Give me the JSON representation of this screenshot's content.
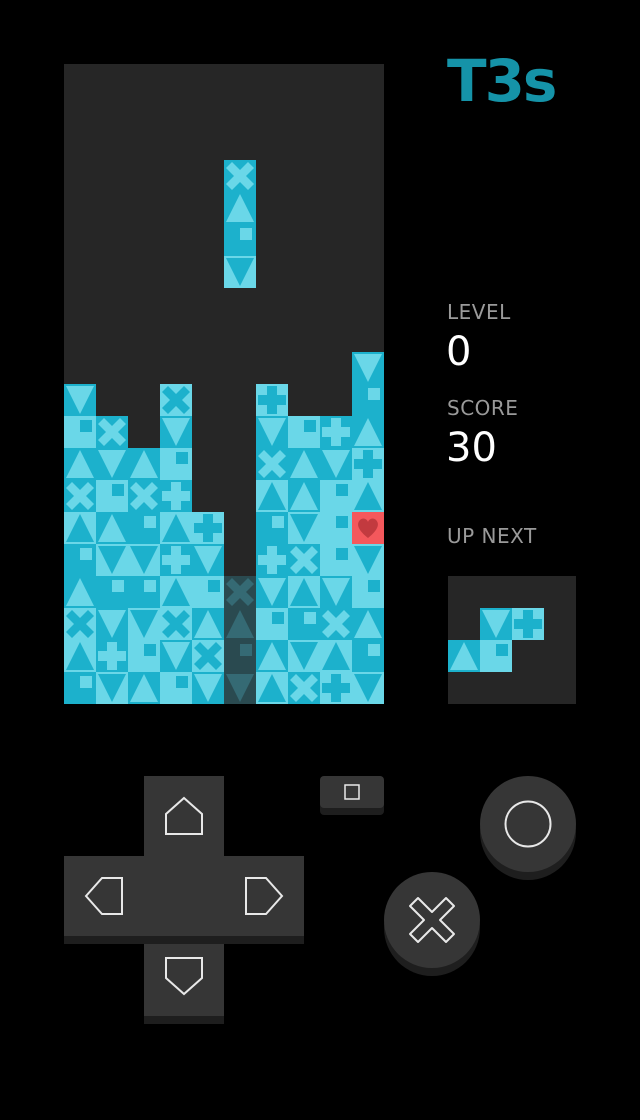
{
  "app_title": "T3s",
  "colors": {
    "board_bg": "#262626",
    "light": "#6ad7e8",
    "medium": "#1cb1cc",
    "ghost": "#2e6068",
    "red": "#f4585c",
    "title": "#1593a8",
    "label": "#9a9a9a"
  },
  "stats": {
    "level_label": "LEVEL",
    "level_value": "0",
    "score_label": "SCORE",
    "score_value": "30",
    "next_label": "UP NEXT"
  },
  "board": {
    "cols": 10,
    "rows": 20,
    "active_piece": [
      {
        "col": 5,
        "row": 3,
        "shape": "x",
        "tone": "m"
      },
      {
        "col": 5,
        "row": 4,
        "shape": "up",
        "tone": "m"
      },
      {
        "col": 5,
        "row": 5,
        "shape": "sq",
        "tone": "m"
      },
      {
        "col": 5,
        "row": 6,
        "shape": "down",
        "tone": "l"
      }
    ],
    "ghost_piece": [
      {
        "col": 5,
        "row": 16,
        "shape": "x"
      },
      {
        "col": 5,
        "row": 17,
        "shape": "up"
      },
      {
        "col": 5,
        "row": 18,
        "shape": "sq"
      },
      {
        "col": 5,
        "row": 19,
        "shape": "down"
      }
    ],
    "stack": [
      [
        "",
        "",
        "",
        "",
        "",
        "",
        "",
        "",
        "",
        "m:down"
      ],
      [
        "m:down",
        "",
        "",
        "l:x",
        "",
        "",
        "l:plus",
        "",
        "",
        "m:sq"
      ],
      [
        "l:sq",
        "m:x",
        "",
        "m:down",
        "",
        "",
        "m:down",
        "l:sq",
        "m:plus",
        "m:up"
      ],
      [
        "m:up",
        "m:down",
        "m:up",
        "l:sq",
        "",
        "",
        "m:x",
        "m:up",
        "m:down",
        "l:plus"
      ],
      [
        "m:x",
        "l:sq",
        "m:x",
        "m:plus",
        "",
        "",
        "l:up",
        "m:up",
        "l:sq",
        "l:up"
      ],
      [
        "l:up",
        "m:up",
        "m:sq",
        "l:up",
        "l:plus",
        "",
        "m:sq",
        "l:down",
        "l:sq",
        "r:heart"
      ],
      [
        "m:sq",
        "l:down",
        "l:down",
        "m:plus",
        "m:down",
        "",
        "m:plus",
        "m:x",
        "l:sq",
        "l:down"
      ],
      [
        "m:up",
        "m:sq",
        "m:sq",
        "l:up",
        "l:sq",
        "",
        "m:down",
        "l:up",
        "m:down",
        "l:sq"
      ],
      [
        "l:x",
        "m:down",
        "l:down",
        "l:x",
        "m:up",
        "",
        "l:sq",
        "m:sq",
        "m:x",
        "m:up"
      ],
      [
        "l:up",
        "m:plus",
        "l:sq",
        "m:down",
        "l:x",
        "",
        "m:up",
        "l:down",
        "l:up",
        "m:sq"
      ],
      [
        "m:sq",
        "l:down",
        "m:up",
        "l:sq",
        "m:down",
        "",
        "l:up",
        "m:x",
        "l:plus",
        "l:down"
      ]
    ]
  },
  "next_piece": [
    {
      "col": 1,
      "row": 1,
      "shape": "down",
      "tone": "m"
    },
    {
      "col": 2,
      "row": 1,
      "shape": "plus",
      "tone": "l"
    },
    {
      "col": 0,
      "row": 2,
      "shape": "up",
      "tone": "m"
    },
    {
      "col": 1,
      "row": 2,
      "shape": "sq",
      "tone": "l"
    }
  ],
  "controls": {
    "dpad_up": "up-arrow-icon",
    "dpad_down": "down-arrow-icon",
    "dpad_left": "left-arrow-icon",
    "dpad_right": "right-arrow-icon",
    "select": "square-icon",
    "circle": "circle-icon",
    "cross": "cross-icon"
  }
}
